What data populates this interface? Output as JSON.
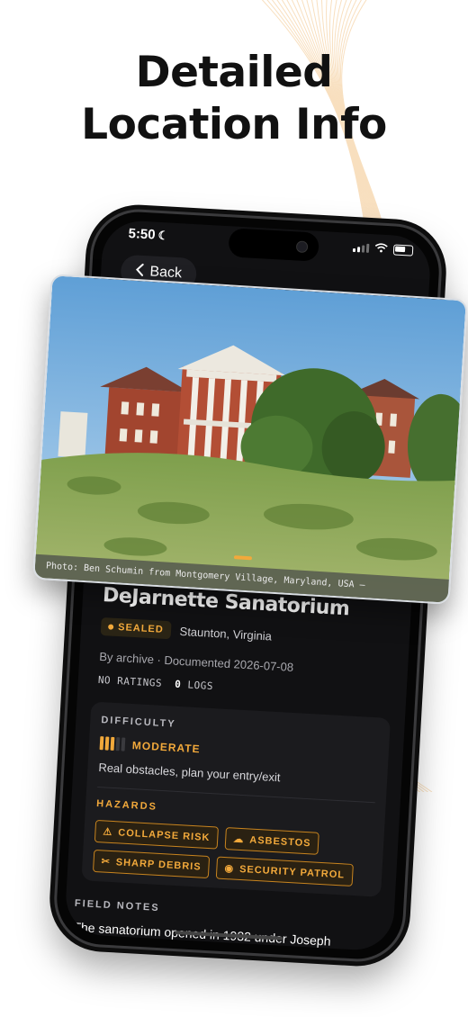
{
  "headline": {
    "line1": "Detailed",
    "line2": "Location Info"
  },
  "status": {
    "time": "5:50"
  },
  "nav": {
    "back_label": "Back"
  },
  "photo": {
    "caption": "Photo: Ben Schumin from Montgomery Village, Maryland, USA —"
  },
  "location": {
    "title": "DeJarnette Sanatorium",
    "status_badge": "SEALED",
    "place": "Staunton, Virginia",
    "byline": "By archive · Documented 2026-07-08",
    "ratings_text": "NO RATINGS",
    "logs_count": "0",
    "logs_label": "LOGS"
  },
  "difficulty": {
    "label": "DIFFICULTY",
    "value": "MODERATE",
    "level": 3,
    "max": 5,
    "description": "Real obstacles, plan your entry/exit"
  },
  "hazards": {
    "label": "HAZARDS",
    "items": [
      {
        "icon": "warning-icon",
        "label": "COLLAPSE RISK"
      },
      {
        "icon": "cloud-icon",
        "label": "ASBESTOS"
      },
      {
        "icon": "scissors-icon",
        "label": "SHARP DEBRIS"
      },
      {
        "icon": "eye-icon",
        "label": "SECURITY PATROL"
      }
    ]
  },
  "field_notes": {
    "label": "FIELD NOTES",
    "text": "The sanatorium opened in 1932 under Joseph"
  },
  "colors": {
    "accent": "#f2a93b",
    "background": "#111113",
    "card": "#1b1b1e"
  }
}
